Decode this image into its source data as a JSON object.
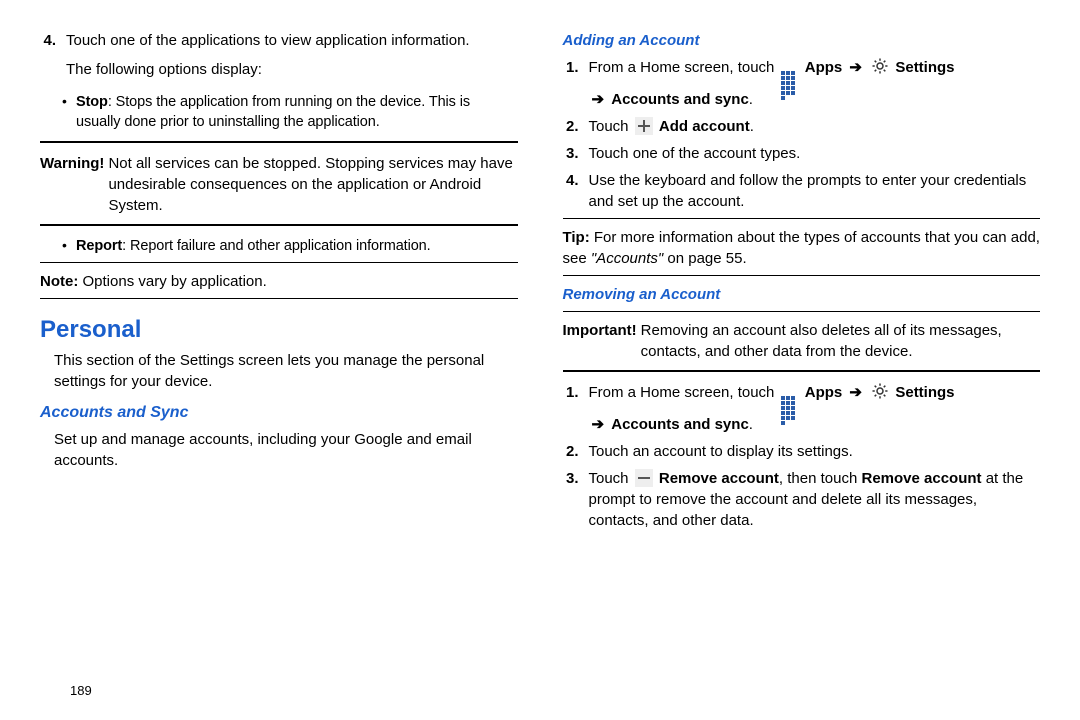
{
  "page_number": "189",
  "left": {
    "step4_num": "4.",
    "step4_text": "Touch one of the applications to view application information.",
    "step4_sub": "The following options display:",
    "bullet_stop_label": "Stop",
    "bullet_stop_text": ": Stops the application from running on the device. This is usually done prior to uninstalling the application.",
    "warning_lead": "Warning!",
    "warning_text": "Not all services can be stopped. Stopping services may have undesirable consequences on the application or Android System.",
    "bullet_report_label": "Report",
    "bullet_report_text": ": Report failure and other application information.",
    "note_lead": "Note:",
    "note_text": "Options vary by application.",
    "h1": "Personal",
    "personal_para": "This section of the Settings screen lets you manage the personal settings for your device.",
    "h2": "Accounts and Sync",
    "accounts_para": "Set up and manage accounts, including your Google and email accounts."
  },
  "right": {
    "h3_adding": "Adding an Account",
    "add1_num": "1.",
    "add1_pre": "From a Home screen, touch ",
    "apps_label": "Apps",
    "settings_label": "Settings",
    "accounts_sync_label": "Accounts and sync",
    "add2_num": "2.",
    "add2_pre": "Touch ",
    "add2_label": "Add account",
    "add3_num": "3.",
    "add3_text": "Touch one of the account types.",
    "add4_num": "4.",
    "add4_text": "Use the keyboard and follow the prompts to enter your credentials and set up the account.",
    "tip_lead": "Tip:",
    "tip_pre": "For more information about the types of accounts that you can add, see ",
    "tip_ref": "\"Accounts\"",
    "tip_post": " on page 55.",
    "h3_removing": "Removing an Account",
    "important_lead": "Important!",
    "important_text": "Removing an account also deletes all of its messages, contacts, and other data from the device.",
    "rem1_num": "1.",
    "rem1_pre": "From a Home screen, touch ",
    "rem2_num": "2.",
    "rem2_text": "Touch an account to display its settings.",
    "rem3_num": "3.",
    "rem3_pre": "Touch ",
    "rem3_label": "Remove account",
    "rem3_mid": ", then touch ",
    "rem3_label2": "Remove account",
    "rem3_post": " at the prompt to remove the account and delete all its messages, contacts, and other data."
  },
  "arrow": "➔",
  "arrow2": "➔",
  "period": "."
}
